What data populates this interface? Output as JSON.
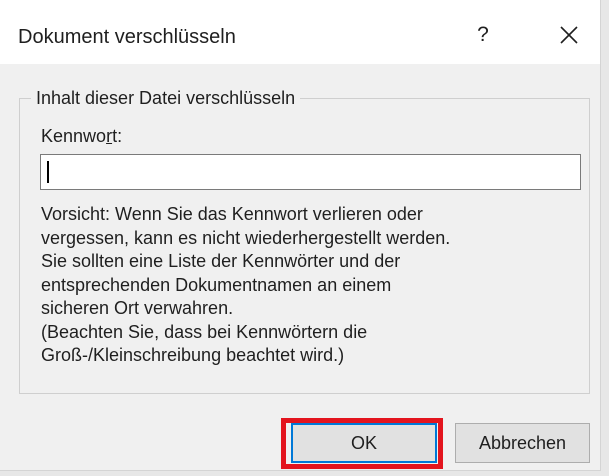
{
  "dialog": {
    "title": "Dokument verschlüsseln",
    "help_label": "?"
  },
  "group": {
    "legend": "Inhalt dieser Datei verschlüsseln"
  },
  "password": {
    "label_pre": "Kennwo",
    "label_accel": "r",
    "label_post": "t:",
    "value": ""
  },
  "warning": {
    "lines": [
      "Vorsicht: Wenn Sie das Kennwort verlieren oder",
      "vergessen, kann es nicht wiederhergestellt werden.",
      "Sie sollten eine Liste der Kennwörter und der",
      "entsprechenden Dokumentnamen an einem",
      "sicheren Ort verwahren.",
      "(Beachten Sie, dass bei Kennwörtern die",
      "Groß-/Kleinschreibung beachtet wird.)"
    ]
  },
  "buttons": {
    "ok_label": "OK",
    "cancel_label": "Abbrechen"
  },
  "colors": {
    "highlight": "#e3141e",
    "focus": "#0078d7"
  },
  "icons": {
    "close": "close-icon"
  }
}
